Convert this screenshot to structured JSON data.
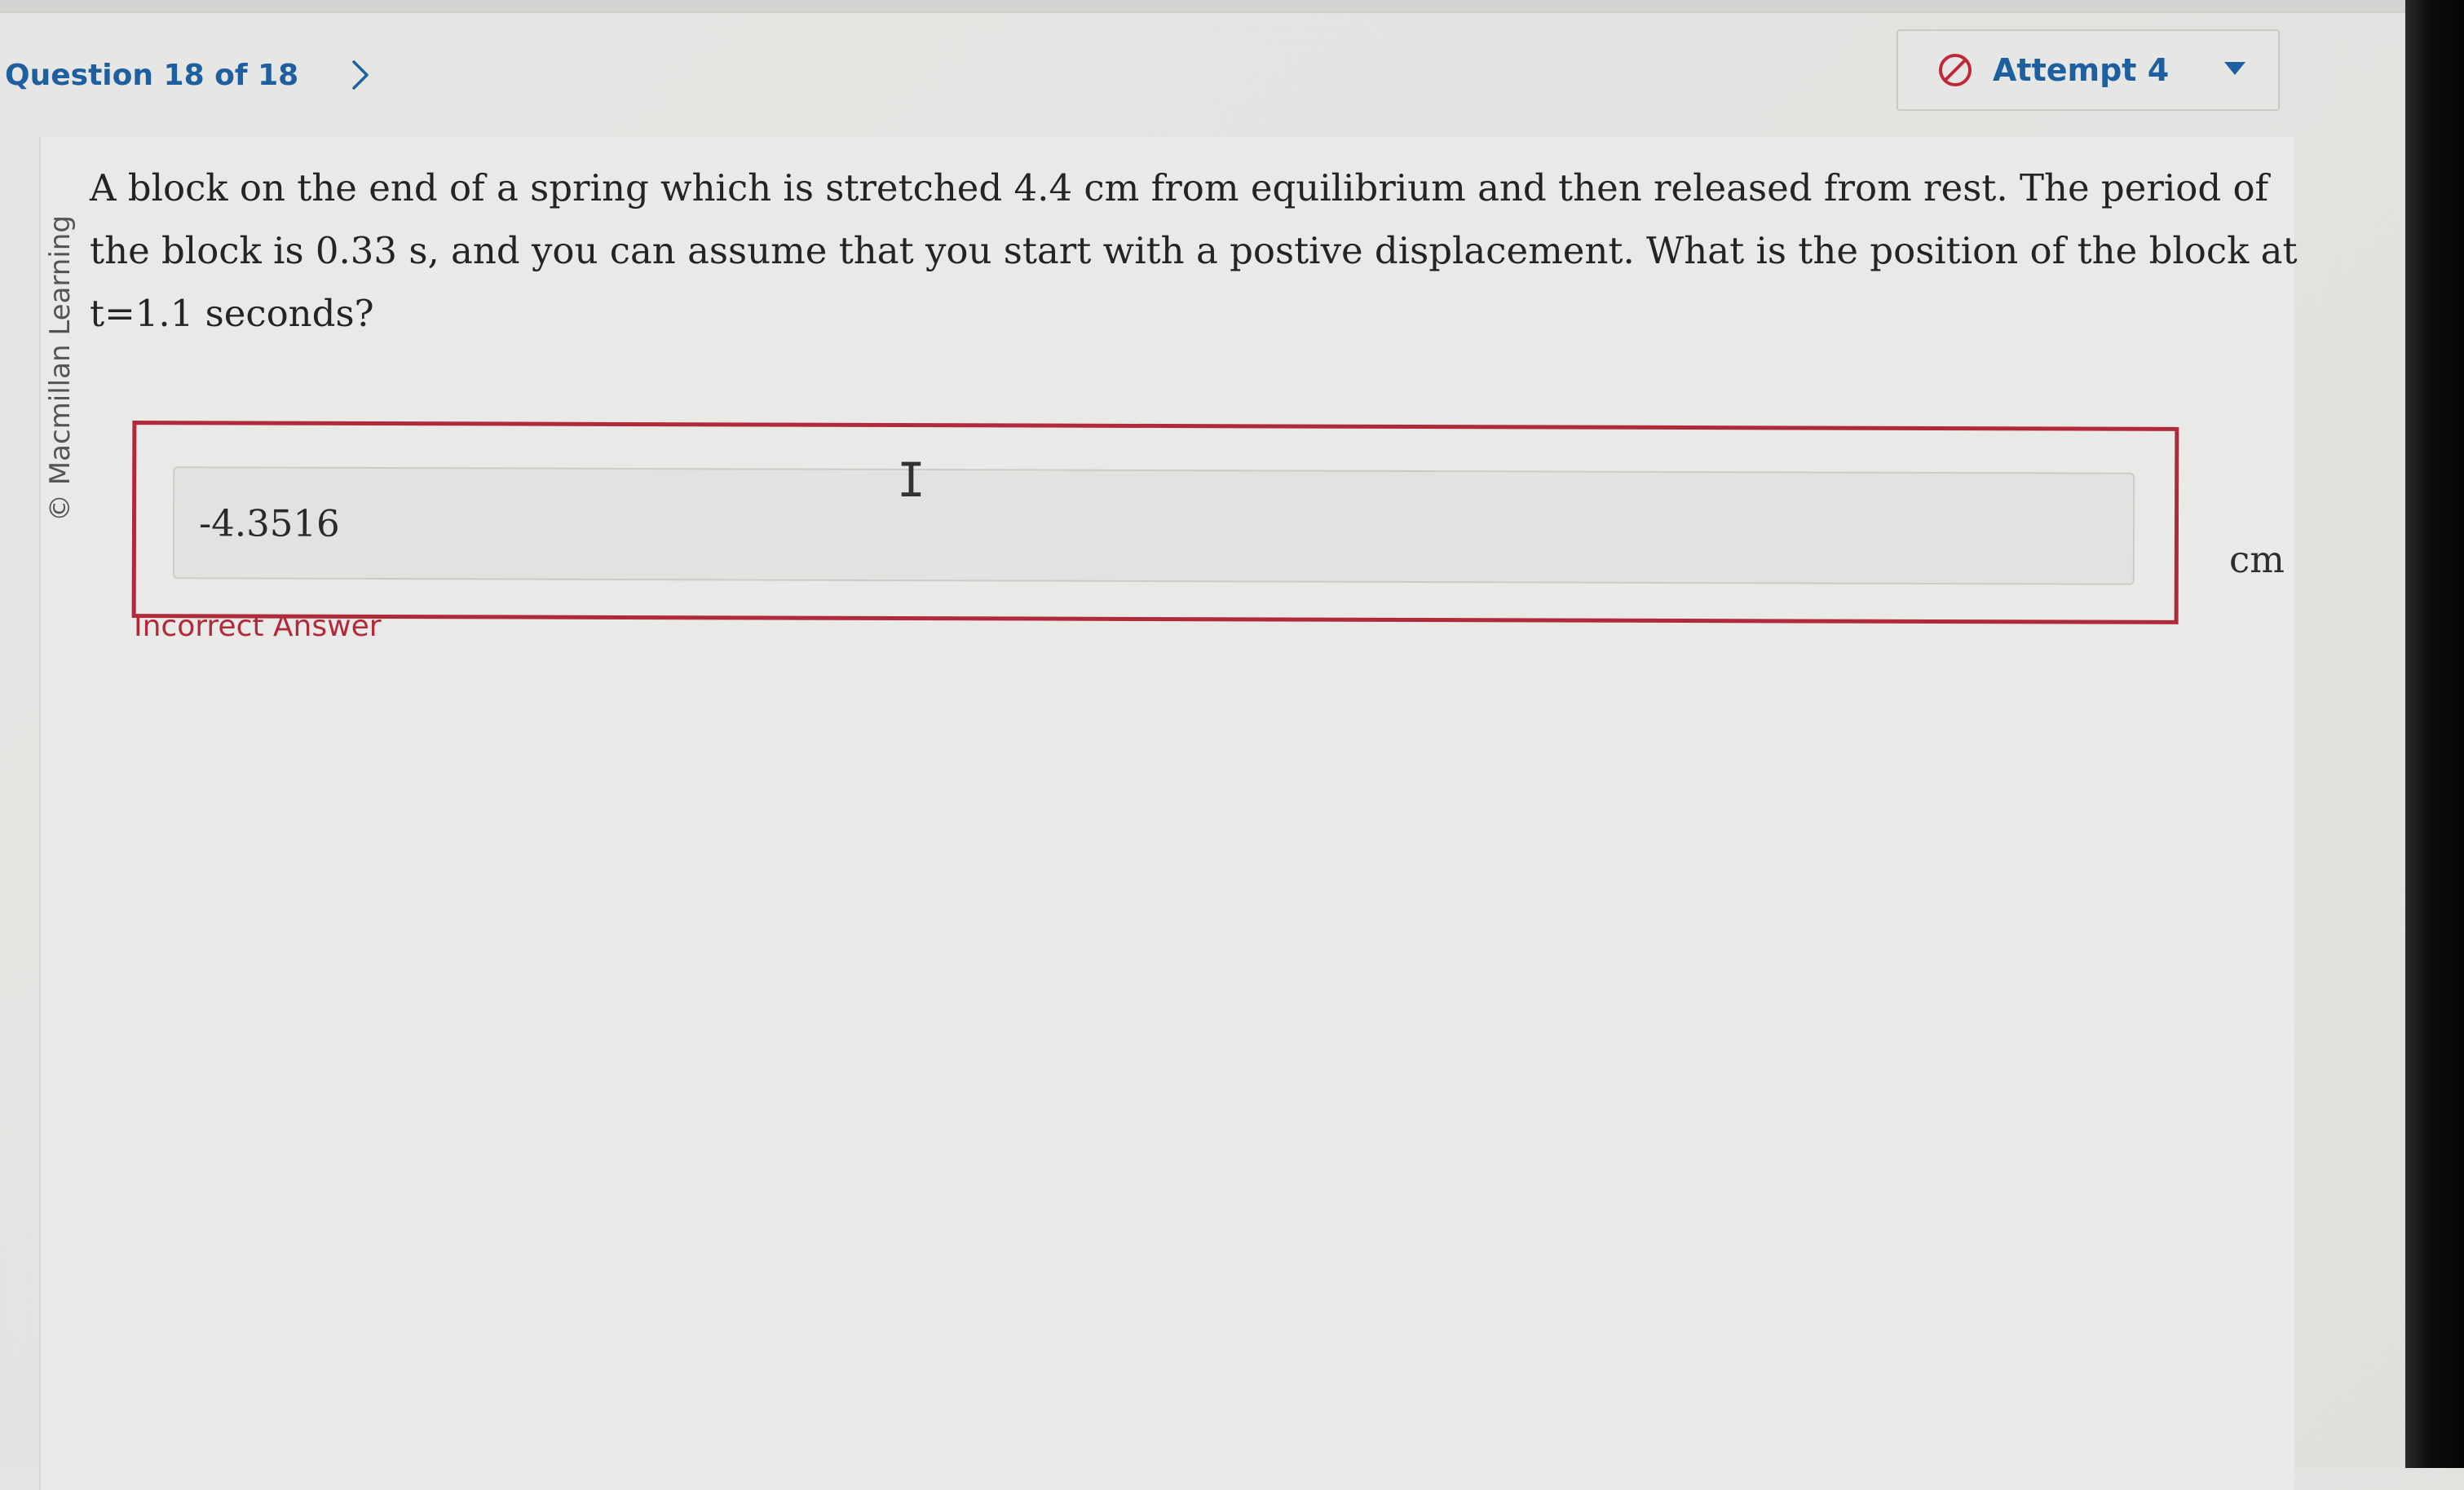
{
  "header": {
    "question_counter": "Question 18 of 18",
    "next_icon": "chevron-right-icon",
    "attempt_label": "Attempt 4",
    "attempt_status_icon": "no-entry-icon",
    "attempt_dropdown_icon": "caret-down-icon"
  },
  "question": {
    "copyright": "© Macmillan Learning",
    "text": "A block on the end of a spring which is stretched 4.4 cm from equilibrium and then released from rest.  The period of the block is 0.33 s, and you can assume that you start with a postive displacement.  What is the position of the block at t=1.1 seconds?",
    "answer_value": "-4.3516",
    "unit": "cm",
    "feedback": "Incorrect Answer"
  },
  "colors": {
    "accent": "#1e5fa0",
    "error": "#b12a3b",
    "bezel": "#0a0a0a"
  }
}
